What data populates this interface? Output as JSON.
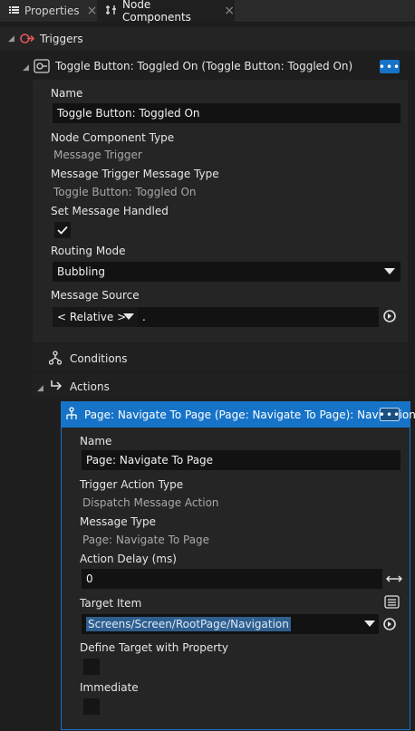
{
  "tabs": [
    {
      "label": "Properties",
      "icon": "list-icon"
    },
    {
      "label": "Node Components",
      "icon": "node-components-icon"
    }
  ],
  "triggers": {
    "label": "Triggers",
    "toggle": {
      "title": "Toggle Button: Toggled On (Toggle Button: Toggled On)",
      "name_label": "Name",
      "name_value": "Toggle Button: Toggled On",
      "nct_label": "Node Component Type",
      "nct_value": "Message Trigger",
      "mtmt_label": "Message Trigger Message Type",
      "mtmt_value": "Toggle Button: Toggled On",
      "smh_label": "Set Message Handled",
      "smh_checked": true,
      "routing_label": "Routing Mode",
      "routing_value": "Bubbling",
      "source_label": "Message Source",
      "source_relative": "< Relative >",
      "source_path": "."
    }
  },
  "conditions": {
    "label": "Conditions"
  },
  "actions": {
    "label": "Actions",
    "navigate": {
      "title": "Page: Navigate To Page (Page: Navigate To Page): Navigation",
      "name_label": "Name",
      "name_value": "Page: Navigate To Page",
      "tat_label": "Trigger Action Type",
      "tat_value": "Dispatch Message Action",
      "mt_label": "Message Type",
      "mt_value": "Page: Navigate To Page",
      "delay_label": "Action Delay (ms)",
      "delay_value": "0",
      "target_label": "Target Item",
      "target_value": "Screens/Screen/RootPage/Navigation",
      "define_label": "Define Target with Property",
      "define_checked": false,
      "immediate_label": "Immediate",
      "immediate_checked": false
    }
  },
  "colors": {
    "accent": "#1673c7",
    "background": "#1e1e1e",
    "panel": "#252526",
    "field": "#121212"
  }
}
